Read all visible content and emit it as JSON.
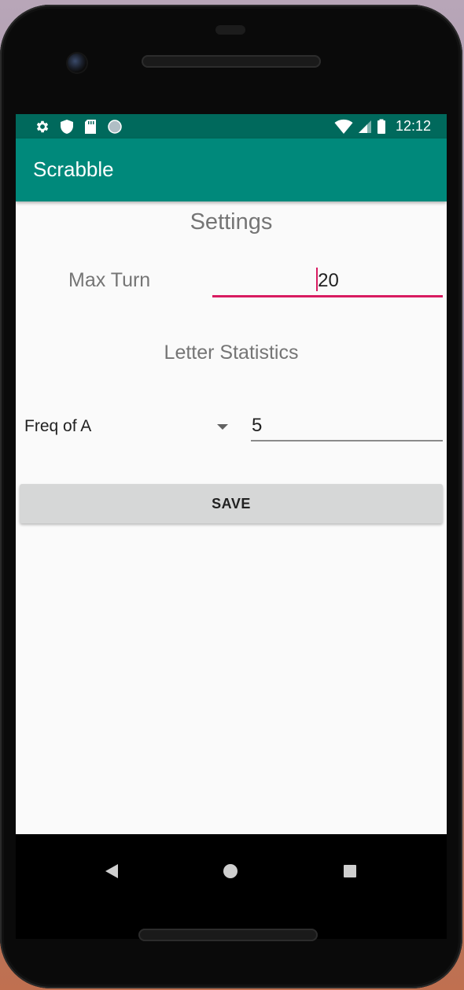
{
  "status_bar": {
    "time": "12:12",
    "icons_left": [
      "settings-icon",
      "shield-icon",
      "sd-card-icon",
      "circle-icon"
    ],
    "icons_right": [
      "wifi-icon",
      "signal-icon",
      "battery-icon"
    ],
    "color": "#00695c"
  },
  "app_bar": {
    "title": "Scrabble",
    "color": "#00897b"
  },
  "settings": {
    "title": "Settings",
    "max_turn": {
      "label": "Max Turn",
      "value": "20"
    },
    "letter_statistics": {
      "title": "Letter Statistics",
      "selected_letter": "Freq of A",
      "frequency_value": "5"
    },
    "save_button": "SAVE"
  },
  "colors": {
    "accent": "#d81b60",
    "label_text": "#757575",
    "button_bg": "#d6d7d7"
  },
  "nav_bar": {
    "icons": [
      "back-icon",
      "home-icon",
      "recents-icon"
    ]
  }
}
